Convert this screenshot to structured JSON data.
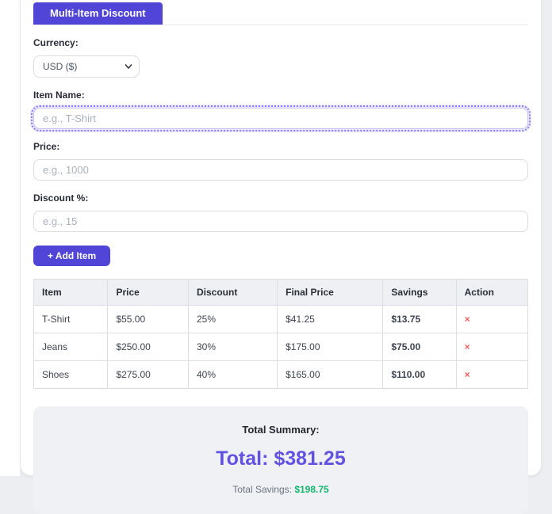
{
  "tab": {
    "label": "Multi-Item Discount"
  },
  "form": {
    "currency": {
      "label": "Currency:",
      "selected": "USD ($)"
    },
    "item_name": {
      "label": "Item Name:",
      "placeholder": "e.g., T-Shirt",
      "value": ""
    },
    "price": {
      "label": "Price:",
      "placeholder": "e.g., 1000",
      "value": ""
    },
    "discount": {
      "label": "Discount %:",
      "placeholder": "e.g., 15",
      "value": ""
    },
    "add_button_label": "+ Add Item"
  },
  "table": {
    "headers": [
      "Item",
      "Price",
      "Discount",
      "Final Price",
      "Savings",
      "Action"
    ],
    "remove_glyph": "×",
    "rows": [
      {
        "item": "T-Shirt",
        "price": "$55.00",
        "discount": "25%",
        "final_price": "$41.25",
        "savings": "$13.75"
      },
      {
        "item": "Jeans",
        "price": "$250.00",
        "discount": "30%",
        "final_price": "$175.00",
        "savings": "$75.00"
      },
      {
        "item": "Shoes",
        "price": "$275.00",
        "discount": "40%",
        "final_price": "$165.00",
        "savings": "$110.00"
      }
    ]
  },
  "summary": {
    "title": "Total Summary:",
    "total_text": "Total: $381.25",
    "savings_label": "Total Savings:",
    "savings_value": "$198.75"
  },
  "colors": {
    "accent_purple": "#5045d6",
    "total_purple": "#6153e0",
    "savings_green": "#13b56e",
    "remove_red": "#f15b5b",
    "summary_bg": "#f0f1f4",
    "table_header_bg": "#eef0f3"
  }
}
